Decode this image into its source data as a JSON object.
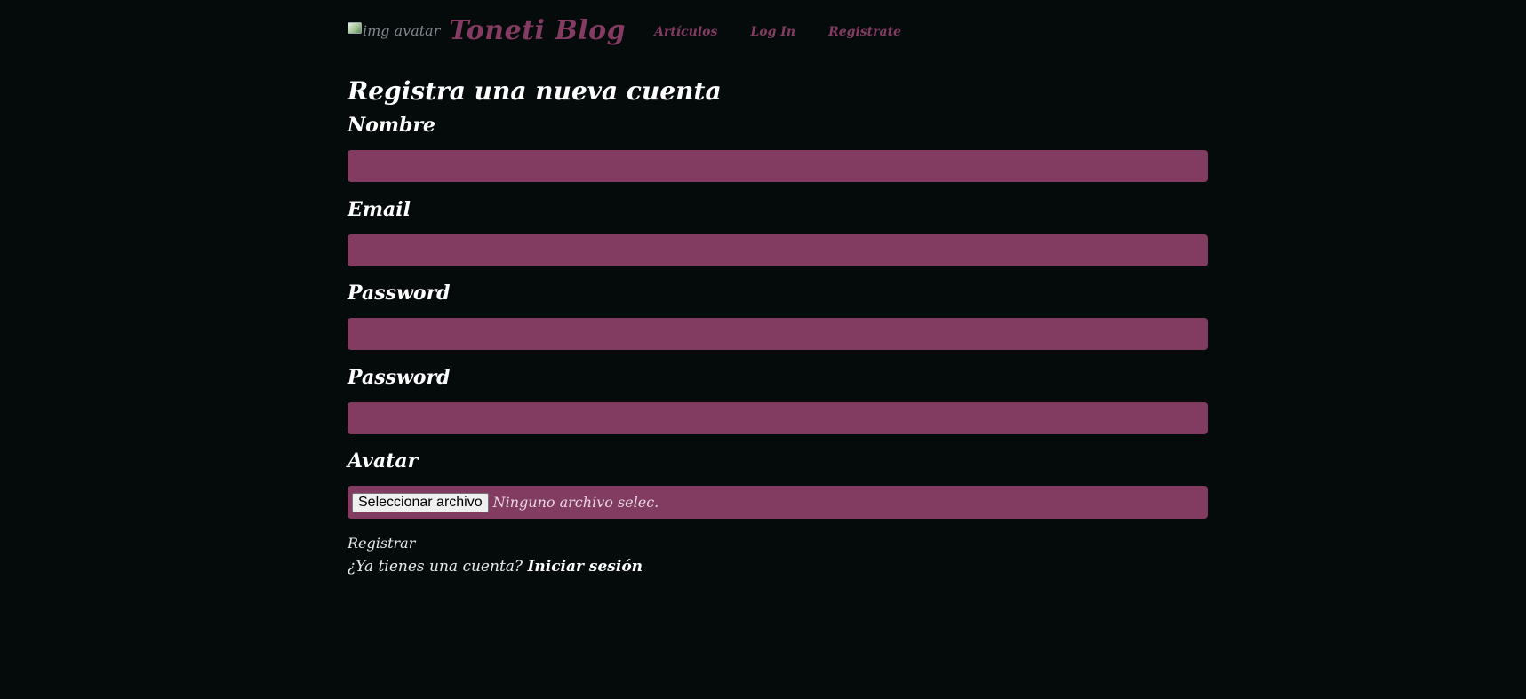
{
  "header": {
    "avatar_alt": "img avatar",
    "brand": "Toneti Blog",
    "nav": [
      {
        "label": "Artículos"
      },
      {
        "label": "Log In"
      },
      {
        "label": "Registrate"
      }
    ]
  },
  "form": {
    "title": "Registra una nueva cuenta",
    "fields": [
      {
        "label": "Nombre",
        "value": ""
      },
      {
        "label": "Email",
        "value": ""
      },
      {
        "label": "Password",
        "value": ""
      },
      {
        "label": "Password",
        "value": ""
      }
    ],
    "avatar": {
      "label": "Avatar",
      "button": "Seleccionar archivo",
      "status": "Ninguno archivo selec."
    },
    "submit": "Registrar",
    "login_prompt": "¿Ya tienes una cuenta?",
    "login_link": "Iniciar sesión"
  },
  "colors": {
    "background": "#050a0b",
    "accent": "#833b62",
    "input_background": "#823b61",
    "text": "#ffffff"
  }
}
